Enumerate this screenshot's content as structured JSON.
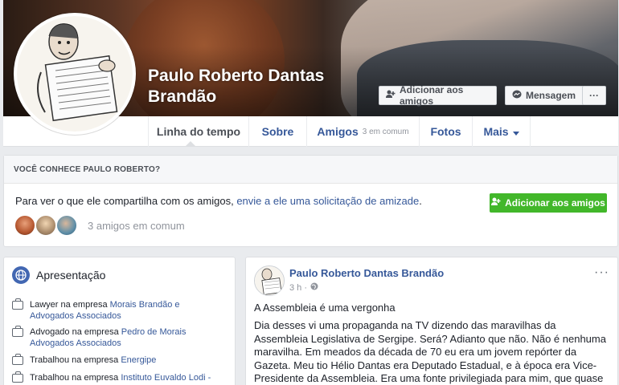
{
  "profile": {
    "name": "Paulo Roberto Dantas Brandão"
  },
  "cover_actions": {
    "add_friend": "Adicionar aos amigos",
    "message": "Mensagem",
    "more": "···"
  },
  "nav": {
    "timeline": "Linha do tempo",
    "about": "Sobre",
    "friends": "Amigos",
    "friends_sub": "3 em comum",
    "photos": "Fotos",
    "more": "Mais"
  },
  "know_box": {
    "header": "VOCÊ CONHECE PAULO ROBERTO?",
    "text_prefix": "Para ver o que ele compartilha com os amigos, ",
    "text_link": "envie a ele uma solicitação de amizade",
    "text_suffix": ".",
    "button": "Adicionar aos amigos",
    "mutual": "3 amigos em comum"
  },
  "intro": {
    "title": "Apresentação",
    "items": [
      {
        "prefix": "Lawyer na empresa ",
        "link": "Morais Brandão e Advogados Associados"
      },
      {
        "prefix": "Advogado na empresa ",
        "link": "Pedro de Morais Advogados Associados"
      },
      {
        "prefix": "Trabalhou na empresa ",
        "link": "Energipe"
      },
      {
        "prefix": "Trabalhou na empresa ",
        "link": "Instituto Euvaldo Lodi -"
      }
    ]
  },
  "post": {
    "author": "Paulo Roberto Dantas Brandão",
    "time": "3 h ·",
    "more": "···",
    "title": "A Assembleia é uma vergonha",
    "body": "Dia desses vi uma propaganda na TV dizendo das maravilhas da Assembleia Legislativa de Sergipe. Será? Adianto que não. Não é nenhuma maravilha. Em meados da década de 70 eu era um jovem repórter da Gazeta. Meu tio Hélio Dantas era Deputado Estadual, e à época era Vice-Presidente da Assembleia. Era uma fonte privilegiada para mim, que quase todo dia passava"
  },
  "colors": {
    "link": "#365899",
    "green": "#42b72a",
    "background": "#e9ebee"
  }
}
